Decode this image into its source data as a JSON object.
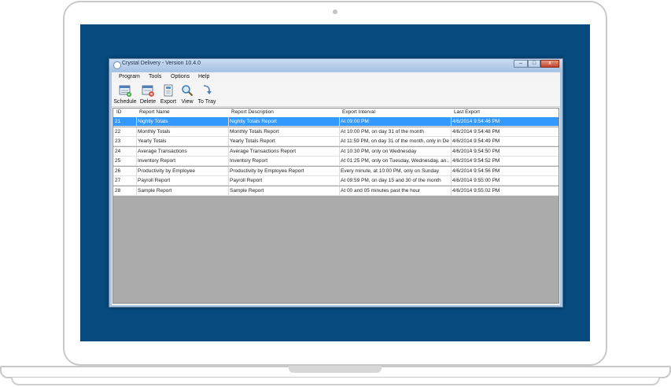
{
  "window": {
    "title": "Crystal Delivery - Version 10.4.0",
    "minimize": "–",
    "maximize": "□",
    "close": "x"
  },
  "menu": [
    "Program",
    "Tools",
    "Options",
    "Help"
  ],
  "toolbar": {
    "schedule": "Schedule",
    "delete": "Delete",
    "export": "Export",
    "view": "View",
    "to_tray": "To Tray"
  },
  "columns": [
    "ID",
    "Report Name",
    "Report Description",
    "Export Interval",
    "Last Export"
  ],
  "rows": [
    {
      "id": "21",
      "name": "Nightly Totals",
      "description": "Nightly Totals Report",
      "interval": "At 09:00 PM",
      "last_export": "4/6/2014 9:54:46 PM",
      "selected": true
    },
    {
      "id": "22",
      "name": "Monthly Totals",
      "description": "Monthly Totals Report",
      "interval": "At 10:00 PM, on day 31 of the month",
      "last_export": "4/6/2014 9:54:48 PM"
    },
    {
      "id": "23",
      "name": "Yearly Totals",
      "description": "Yearly Totals Report",
      "interval": "At 11:59 PM, on day 31 of the month, only in De...",
      "last_export": "4/6/2014 9:54:49 PM"
    },
    {
      "id": "24",
      "name": "Average Transactions",
      "description": "Average Transactions Report",
      "interval": "At 10:30 PM, only on Wednesday",
      "last_export": "4/6/2014 9:54:50 PM"
    },
    {
      "id": "25",
      "name": "Inventory Report",
      "description": "Inventory Report",
      "interval": "At 01:25 PM, only on Tuesday, Wednesday, an...",
      "last_export": "4/6/2014 9:54:52 PM"
    },
    {
      "id": "26",
      "name": "Productivity by Employee",
      "description": "Productivity by Employee Report",
      "interval": "Every minute, at 10:00 PM, only on Sunday",
      "last_export": "4/6/2014 9:54:56 PM"
    },
    {
      "id": "27",
      "name": "Payroll Report",
      "description": "Payroll Report",
      "interval": "At 09:59 PM, on day 15 and 30 of the month",
      "last_export": "4/6/2014 9:55:00 PM"
    },
    {
      "id": "28",
      "name": "Sample Report",
      "description": "Sample Report",
      "interval": "At 00 and 05 minutes past the hour",
      "last_export": "4/6/2014 9:55:02 PM"
    }
  ],
  "colors": {
    "desktop": "#064a7e",
    "selection": "#3399ff",
    "grid_empty": "#ababab"
  },
  "icons": [
    "schedule-icon",
    "delete-icon",
    "export-icon",
    "view-icon",
    "to-tray-icon"
  ]
}
